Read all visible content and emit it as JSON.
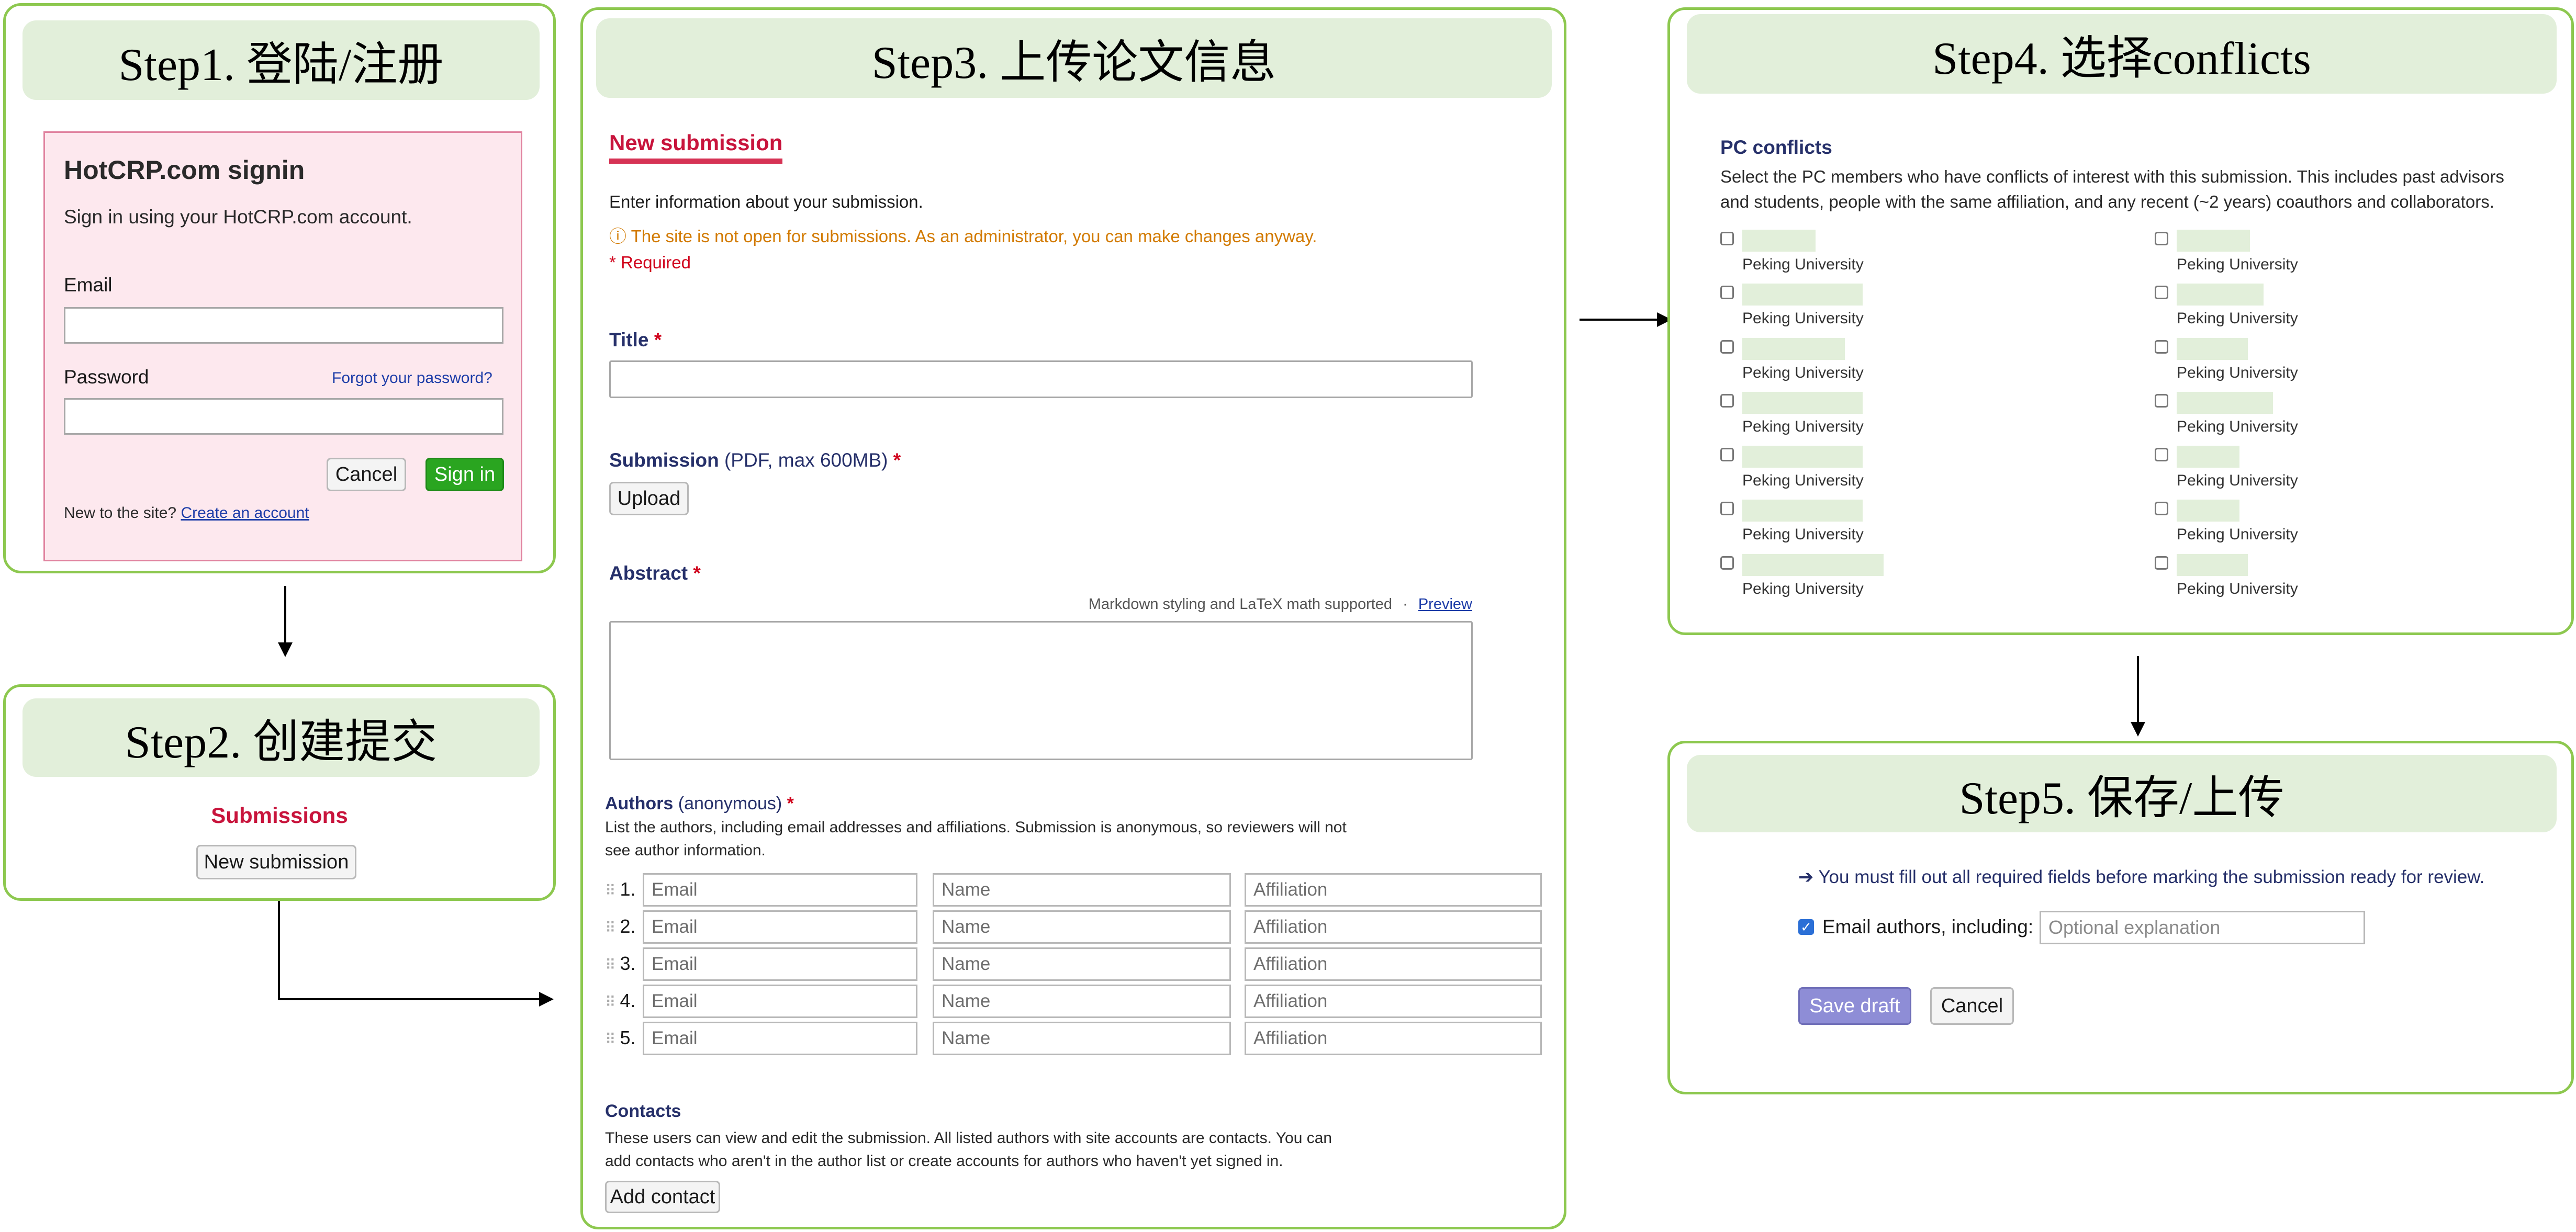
{
  "step1": {
    "title": "Step1. 登陆/注册",
    "signin_heading": "HotCRP.com signin",
    "signin_desc": "Sign in using your HotCRP.com account.",
    "email_label": "Email",
    "password_label": "Password",
    "forgot_link": "Forgot your password?",
    "cancel_label": "Cancel",
    "signin_label": "Sign in",
    "new_site_text": "New to the site?",
    "create_account_link": "Create an account"
  },
  "step2": {
    "title": "Step2. 创建提交",
    "submissions_heading": "Submissions",
    "new_submission_button": "New submission"
  },
  "step3": {
    "title": "Step3. 上传论文信息",
    "heading": "New submission",
    "intro": "Enter information about your submission.",
    "warning": "The site is not open for submissions. As an administrator, you can make changes anyway.",
    "required_note": "* Required",
    "title_label": "Title",
    "submission_label": "Submission",
    "submission_hint": "(PDF, max 600MB)",
    "upload_button": "Upload",
    "abstract_label": "Abstract",
    "markdown_hint": "Markdown styling and LaTeX math supported",
    "preview_link": "Preview",
    "authors_label": "Authors",
    "authors_hint": "(anonymous)",
    "authors_desc_line1": "List the authors, including email addresses and affiliations. Submission is anonymous, so reviewers will not",
    "authors_desc_line2": "see author information.",
    "author_rows": [
      {
        "num": "1.",
        "email": "Email",
        "name": "Name",
        "affiliation": "Affiliation"
      },
      {
        "num": "2.",
        "email": "Email",
        "name": "Name",
        "affiliation": "Affiliation"
      },
      {
        "num": "3.",
        "email": "Email",
        "name": "Name",
        "affiliation": "Affiliation"
      },
      {
        "num": "4.",
        "email": "Email",
        "name": "Name",
        "affiliation": "Affiliation"
      },
      {
        "num": "5.",
        "email": "Email",
        "name": "Name",
        "affiliation": "Affiliation"
      }
    ],
    "contacts_label": "Contacts",
    "contacts_desc_line1": "These users can view and edit the submission. All listed authors with site accounts are contacts. You can",
    "contacts_desc_line2": "add contacts who aren't in the author list or create accounts for authors who haven't yet signed in.",
    "add_contact_button": "Add contact",
    "required_mark": "*"
  },
  "step4": {
    "title": "Step4. 选择conflicts",
    "heading": "PC conflicts",
    "desc_line1": "Select the PC members who have conflicts of interest with this submission. This includes past advisors",
    "desc_line2": "and students, people with the same affiliation, and any recent (~2 years) coauthors and collaborators.",
    "members": [
      {
        "affiliation": "Peking University"
      },
      {
        "affiliation": "Peking University"
      },
      {
        "affiliation": "Peking University"
      },
      {
        "affiliation": "Peking University"
      },
      {
        "affiliation": "Peking University"
      },
      {
        "affiliation": "Peking University"
      },
      {
        "affiliation": "Peking University"
      },
      {
        "affiliation": "Peking University"
      },
      {
        "affiliation": "Peking University"
      },
      {
        "affiliation": "Peking University"
      },
      {
        "affiliation": "Peking University"
      },
      {
        "affiliation": "Peking University"
      },
      {
        "affiliation": "Peking University"
      },
      {
        "affiliation": "Peking University"
      }
    ]
  },
  "step5": {
    "title": "Step5. 保存/上传",
    "notice": "You must fill out all required fields before marking the submission ready for review.",
    "email_authors_label": "Email authors, including:",
    "explanation_placeholder": "Optional explanation",
    "save_draft_button": "Save draft",
    "cancel_button": "Cancel"
  },
  "colors": {
    "panel_border": "#8dc84f",
    "title_bg": "#e2efda",
    "signin_bg": "#fde8ee",
    "signin_button": "#2aa520",
    "heading_red": "#c8143c",
    "label_navy": "#26306a",
    "warning_orange": "#d27a00",
    "save_button": "#8e8dd6"
  }
}
